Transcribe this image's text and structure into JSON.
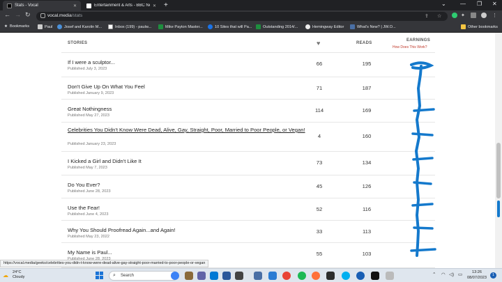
{
  "browser": {
    "tabs": [
      {
        "label": "Stats - Vocal",
        "active": true
      },
      {
        "label": "Entertainment & Arts - BBC News",
        "active": false
      }
    ],
    "url_host": "vocal.media",
    "url_path": "/stats",
    "bookmarks": [
      "Bookmarks",
      "Paul",
      "Josef and Karolin M...",
      "Inbox (199) - paulw...",
      "Mike Payton Master...",
      "10 Sites that will Pa...",
      "Outstanding 2014/...",
      "Hemingway Editor",
      "What's New? | JW.O...",
      "Other bookmarks"
    ]
  },
  "table": {
    "headers": {
      "stories": "STORIES",
      "reads": "READS",
      "earnings": "EARNINGS",
      "how_link": "How Does This Work?"
    },
    "rows": [
      {
        "title": "If I were a sculptor...",
        "published": "Published July 3, 2023",
        "likes": "66",
        "reads": "195",
        "underlined": false
      },
      {
        "title": "Don't Give Up On What You Feel",
        "published": "Published January 9, 2023",
        "likes": "71",
        "reads": "187",
        "underlined": false
      },
      {
        "title": "Great Nothingness",
        "published": "Published May 27, 2023",
        "likes": "114",
        "reads": "169",
        "underlined": false
      },
      {
        "title": "Celebrities You Didn't Know Were Dead, Alive, Gay, Straight, Poor, Married to Poor People, or Vegan!",
        "published": "Published January 23, 2023",
        "likes": "4",
        "reads": "160",
        "underlined": true
      },
      {
        "title": "I Kicked a Girl and Didn't Like It",
        "published": "Published May 7, 2023",
        "likes": "73",
        "reads": "134",
        "underlined": false
      },
      {
        "title": "Do You Ever?",
        "published": "Published June 28, 2023",
        "likes": "45",
        "reads": "126",
        "underlined": false
      },
      {
        "title": "Use the Fear!",
        "published": "Published June 4, 2023",
        "likes": "52",
        "reads": "116",
        "underlined": false
      },
      {
        "title": "Why You Should Proofread Again...and Again!",
        "published": "Published May 23, 2022",
        "likes": "33",
        "reads": "113",
        "underlined": false
      },
      {
        "title": "My Name is Paul...",
        "published": "Published June 28, 2023",
        "likes": "55",
        "reads": "103",
        "underlined": false
      }
    ]
  },
  "status_url": "https://vocal.media/geeks/celebrities-you-didn-t-know-were-dead-alive-gay-straight-poor-married-to-poor-people-or-vegan",
  "taskbar": {
    "temp": "24°C",
    "weather": "Cloudy",
    "search": "Search",
    "time": "13:26",
    "date": "08/07/2023",
    "notifications": "1"
  },
  "colors": {
    "scribble": "#1479cc",
    "link": "#c0392b"
  }
}
